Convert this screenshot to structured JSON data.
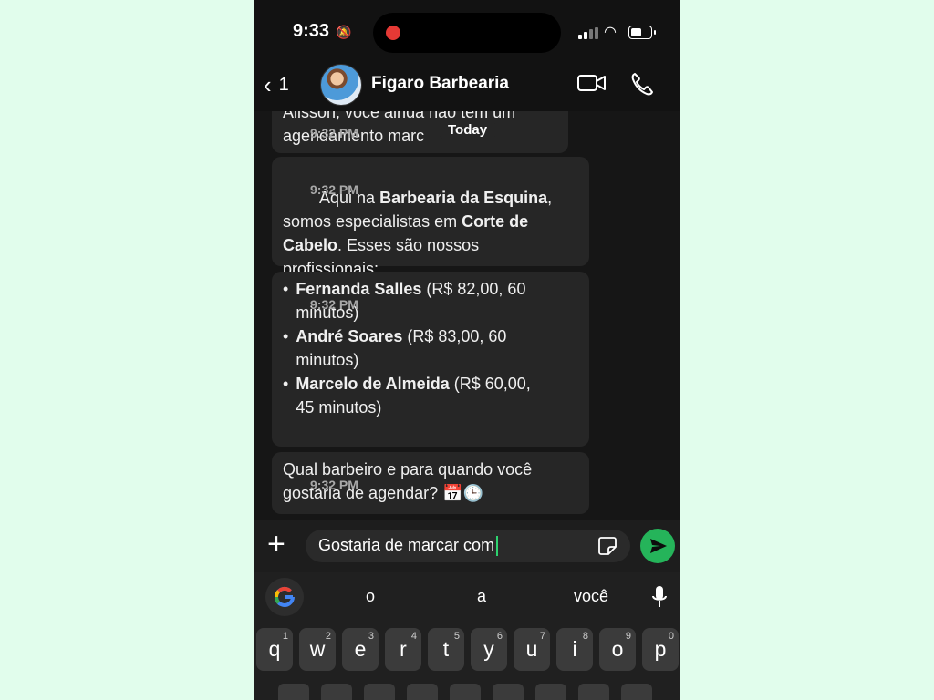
{
  "status_bar": {
    "time": "9:33",
    "icons": [
      "silent-bell-icon",
      "signal-icon",
      "wifi-icon",
      "battery-icon"
    ]
  },
  "header": {
    "back_count": "1",
    "title": "Figaro Barbearia"
  },
  "chat": {
    "day_chip": "Today",
    "messages": [
      {
        "text": "Alisson, você ainda não tem um\nagendamento marc",
        "time": "9:32 PM"
      },
      {
        "parts": [
          {
            "t": "Aqui na ",
            "b": false
          },
          {
            "t": "Barbearia da Esquina",
            "b": true
          },
          {
            "t": ",\nsomos especialistas em ",
            "b": false
          },
          {
            "t": "Corte de\nCabelo",
            "b": true
          },
          {
            "t": ". Esses são nossos\nprofissionais:",
            "b": false
          }
        ],
        "time": "9:32 PM"
      },
      {
        "items": [
          {
            "name": "Fernanda Salles",
            "detail": " (R$ 82,00, 60\nminutos)"
          },
          {
            "name": "André Soares",
            "detail": " (R$ 83,00, 60\nminutos)"
          },
          {
            "name": "Marcelo de Almeida",
            "detail": " (R$ 60,00,\n45 minutos)"
          }
        ],
        "time": "9:32 PM"
      },
      {
        "text": "Qual barbeiro e para quando você\ngostaria de agendar? 📅🕒",
        "time": "9:32 PM"
      }
    ]
  },
  "composer": {
    "input_value": "Gostaria de marcar com"
  },
  "keyboard": {
    "suggestions": [
      "o",
      "a",
      "você"
    ],
    "keys": [
      {
        "k": "q",
        "n": "1"
      },
      {
        "k": "w",
        "n": "2"
      },
      {
        "k": "e",
        "n": "3"
      },
      {
        "k": "r",
        "n": "4"
      },
      {
        "k": "t",
        "n": "5"
      },
      {
        "k": "y",
        "n": "6"
      },
      {
        "k": "u",
        "n": "7"
      },
      {
        "k": "i",
        "n": "8"
      },
      {
        "k": "o",
        "n": "9"
      },
      {
        "k": "p",
        "n": "0"
      }
    ]
  },
  "colors": {
    "page_background": "#e1fdec",
    "send_button": "#25b45a",
    "bubble": "#262626",
    "cursor": "#2dd36f"
  }
}
